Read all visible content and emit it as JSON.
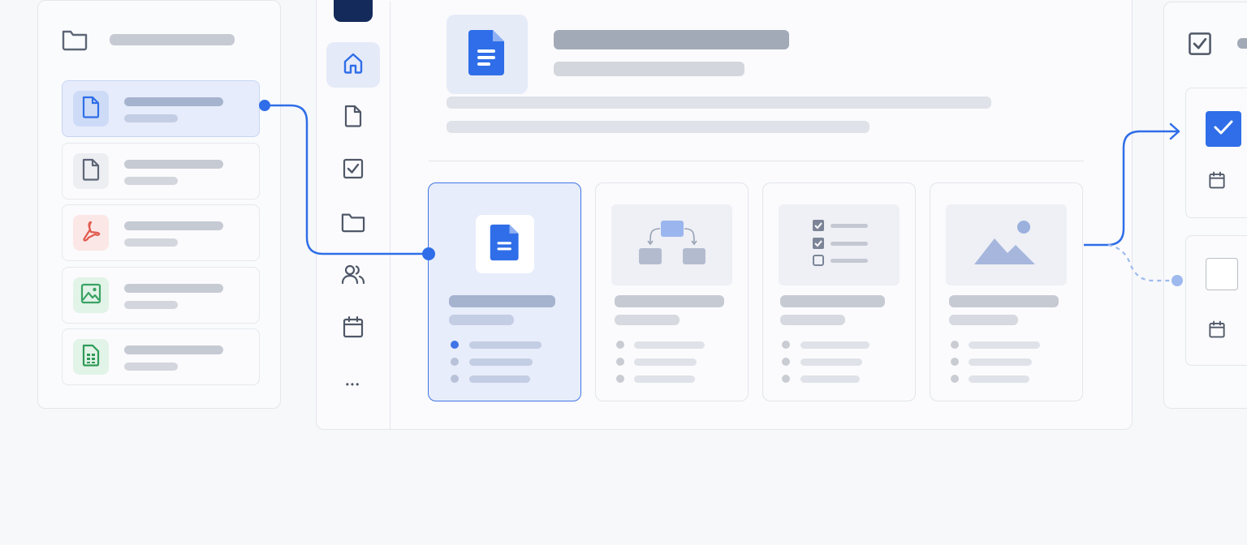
{
  "app": {
    "title": ""
  },
  "colors": {
    "accent": "#2f6ee8",
    "accent_light": "#e6ecfb",
    "background": "#f7f8fa",
    "dark_tab": "#142a5a",
    "pdf_red": "#e05a4e",
    "image_green": "#3aa364",
    "sheet_green": "#2f9a58"
  },
  "left_panel": {
    "header_icon": "folder-icon",
    "files": [
      {
        "icon": "document-icon",
        "state": "selected"
      },
      {
        "icon": "document-icon",
        "state": "default"
      },
      {
        "icon": "pdf-icon",
        "state": "default"
      },
      {
        "icon": "image-icon",
        "state": "default"
      },
      {
        "icon": "spreadsheet-icon",
        "state": "default"
      }
    ]
  },
  "nav_rail": {
    "items": [
      {
        "icon": "home-icon",
        "state": "active"
      },
      {
        "icon": "document-icon",
        "state": "default"
      },
      {
        "icon": "checkbox-icon",
        "state": "default"
      },
      {
        "icon": "folder-icon",
        "state": "default"
      },
      {
        "icon": "users-icon",
        "state": "default"
      },
      {
        "icon": "calendar-icon",
        "state": "default"
      },
      {
        "icon": "more-icon",
        "state": "default"
      }
    ],
    "more_glyph": "•••"
  },
  "main": {
    "header_icon": "google-doc-icon",
    "cards": [
      {
        "icon": "google-doc-icon",
        "state": "selected"
      },
      {
        "icon": "flowchart-icon",
        "state": "default"
      },
      {
        "icon": "checklist-icon",
        "state": "default"
      },
      {
        "icon": "landscape-image-icon",
        "state": "default"
      }
    ]
  },
  "right_panel": {
    "header_icon": "checkbox-icon",
    "tasks": [
      {
        "checked": true,
        "icon": "calendar-icon"
      },
      {
        "checked": false,
        "icon": "calendar-icon"
      }
    ]
  }
}
